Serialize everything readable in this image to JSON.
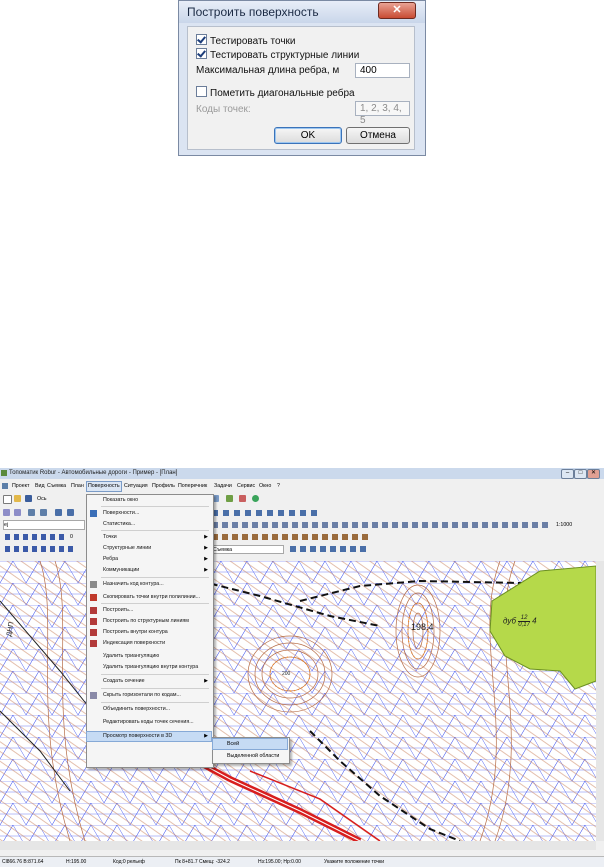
{
  "dialog": {
    "title": "Построить поверхность",
    "close_label": "✕",
    "test_points_label": "Тестировать точки",
    "test_points_checked": true,
    "test_lines_label": "Тестировать структурные линии",
    "test_lines_checked": true,
    "max_edge_label": "Максимальная длина ребра, м",
    "max_edge_value": "400",
    "mark_diag_label": "Пометить диагональные ребра",
    "mark_diag_checked": false,
    "point_codes_label": "Коды точек:",
    "point_codes_value": "1, 2, 3, 4, 5",
    "ok_label": "OK",
    "cancel_label": "Отмена"
  },
  "app": {
    "title": "Топоматик Robur - Автомобильные дороги - Пример - [План]",
    "window_buttons": [
      "–",
      "□",
      "✕"
    ],
    "menu": [
      "Проект",
      "Вид",
      "Съемка",
      "План",
      "Поверхность",
      "Ситуация",
      "Профиль",
      "Поперечник",
      "Задачи",
      "Сервис",
      "Окно",
      "?"
    ],
    "toolbar_fields": {
      "layer": "Ось",
      "style": "ej",
      "number": "0",
      "scale": "1:1000",
      "survey": "Съемка"
    },
    "surface_menu": [
      {
        "label": "Показать окно",
        "icon": "window-icon",
        "submenu": false
      },
      {
        "label": "Поверхности...",
        "icon": "surfaces-icon",
        "submenu": false
      },
      {
        "label": "Статистика...",
        "icon": "",
        "submenu": false
      },
      {
        "label": "Точки",
        "icon": "",
        "submenu": true
      },
      {
        "label": "Структурные линии",
        "icon": "",
        "submenu": true
      },
      {
        "label": "Ребра",
        "icon": "",
        "submenu": true
      },
      {
        "label": "Коммуникации",
        "icon": "",
        "submenu": true
      },
      {
        "label": "Назначить код контура...",
        "icon": "contour-code-icon",
        "submenu": false
      },
      {
        "label": "Скопировать точки внутри полилинии...",
        "icon": "copy-points-icon",
        "submenu": false
      },
      {
        "label": "Построить...",
        "icon": "build-icon",
        "submenu": false
      },
      {
        "label": "Построить по структурным линиям",
        "icon": "build-lines-icon",
        "submenu": false
      },
      {
        "label": "Построить внутри контура",
        "icon": "build-contour-icon",
        "submenu": false
      },
      {
        "label": "Индексация поверхности",
        "icon": "index-icon",
        "submenu": false
      },
      {
        "label": "Удалить триангуляцию",
        "icon": "",
        "submenu": false
      },
      {
        "label": "Удалить триангуляцию внутри контура",
        "icon": "",
        "submenu": false
      },
      {
        "label": "Создать сечение",
        "icon": "",
        "submenu": true
      },
      {
        "label": "Скрыть горизонтали по кодам...",
        "icon": "hide-contours-icon",
        "submenu": false
      },
      {
        "label": "Объединить поверхности...",
        "icon": "",
        "submenu": false
      },
      {
        "label": "Редактировать коды точек сечения...",
        "icon": "",
        "submenu": false
      },
      {
        "label": "Просмотр поверхности в 3D",
        "icon": "",
        "submenu": true
      }
    ],
    "submenu_3d": [
      "Всей",
      "Выделенной области"
    ],
    "map_labels": {
      "elevation1": "198.4",
      "elevation2": "200",
      "tree_prefix": "дуб",
      "tree_num": "12",
      "tree_den": "0,17",
      "tree_suffix": "4",
      "road_label": "ДНП"
    },
    "status": [
      "Сl866.76 В:871.64",
      "Н:195.00",
      "Код:0 рельеф",
      "Пк 8+81.7  Смещ: -324.2",
      "Нз:195.00; Нр:0.00",
      "Укажите положение точки"
    ],
    "colors": {
      "accent": "#3b73b9",
      "menu_highlight": "#c6dbf4",
      "road": "#d81e1e",
      "vegetation": "#b5d94a",
      "triangulation": "#3c4ee8"
    }
  }
}
